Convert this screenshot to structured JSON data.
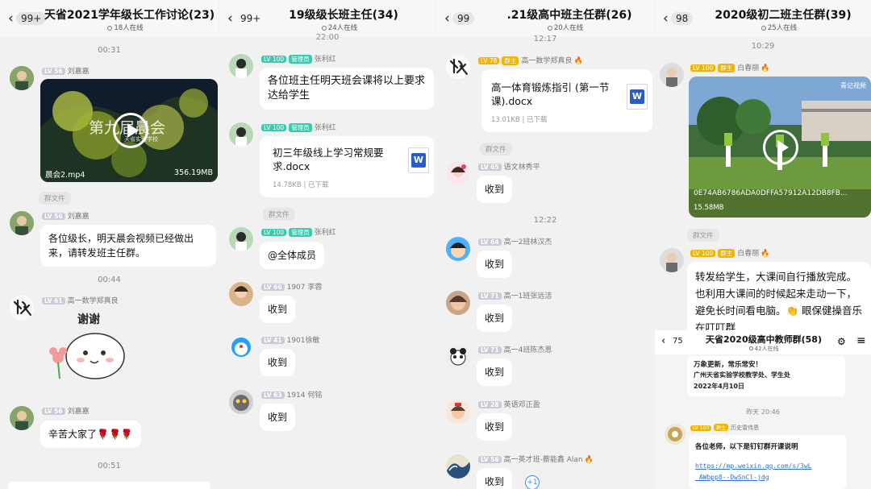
{
  "panel1": {
    "unread": "99+",
    "title": "天省2021学年级长工作讨论(23)",
    "online": "18人在线",
    "time1": "00:31",
    "msg1": {
      "lv": "LV 56",
      "name": "刘嘉嘉",
      "video_file": "晨会2.mp4",
      "video_size": "356.19MB",
      "video_text": "第九届晨会",
      "video_sub": "天省实验学校"
    },
    "badge": "群文件",
    "msg2": {
      "lv": "LV 56",
      "name": "刘嘉嘉",
      "text": "各位级长，明天晨会视频已经做出来，请转发班主任群。"
    },
    "time2": "00:44",
    "msg3": {
      "lv": "LV 61",
      "name": "高一数学郑真良",
      "sticker_text": "谢谢"
    },
    "msg4": {
      "lv": "LV 56",
      "name": "刘嘉嘉",
      "text": "辛苦大家了🌹🌹🌹"
    },
    "time3": "00:51"
  },
  "panel2": {
    "unread": "99+",
    "title": "19级级长班主任(34)",
    "online": "24人在线",
    "time1": "22:00",
    "msg1": {
      "lv": "LV 100",
      "role": "管理员",
      "name": "张利红",
      "text": "各位班主任明天班会课将以上要求达给学生"
    },
    "msg2": {
      "lv": "LV 100",
      "role": "管理员",
      "name": "张利红",
      "file": "初三年级线上学习常规要求.docx",
      "size": "14.78KB | 已下载"
    },
    "badge": "群文件",
    "msg3": {
      "lv": "LV 100",
      "role": "管理员",
      "name": "张利红",
      "text": "@全体成员"
    },
    "msg4": {
      "lv": "LV 66",
      "name": "1907 李蓉",
      "text": "收到"
    },
    "msg5": {
      "lv": "LV 41",
      "name": "1901徐敏",
      "text": "收到"
    },
    "msg6": {
      "lv": "LV 63",
      "name": "1914 何铭",
      "text": "收到"
    }
  },
  "panel3": {
    "unread": "99",
    "title": ".21级高中班主任群(26)",
    "online": "20人在线",
    "time1": "12:17",
    "msg1": {
      "lv": "LV 78",
      "role": "群主",
      "name": "高一数学郑真良",
      "file": "高一体育锻炼指引 (第一节课).docx",
      "size": "13.01KB | 已下载"
    },
    "badge": "群文件",
    "msg2": {
      "lv": "LV 65",
      "name": "语文林秀平",
      "text": "收到"
    },
    "time2": "12:22",
    "msg3": {
      "lv": "LV 64",
      "name": "高一2班林汉杰",
      "text": "收到"
    },
    "msg4": {
      "lv": "LV 71",
      "name": "高一1班张远洁",
      "text": "收到"
    },
    "msg5": {
      "lv": "LV 71",
      "name": "高一4班陈杰恩",
      "text": "收到"
    },
    "msg6": {
      "lv": "LV 28",
      "name": "英语邓正盈",
      "text": "收到"
    },
    "msg7": {
      "lv": "LV 56",
      "name": "高一英才班-蔡能鑫 Alan",
      "text": "收到"
    },
    "plus": "+1"
  },
  "panel4": {
    "unread": "98",
    "title": "2020级初二班主任群(39)",
    "online": "25人在线",
    "time1": "10:29",
    "msg1": {
      "lv": "LV 100",
      "role": "群主",
      "name": "白春丽",
      "video_file": "0E74AB6786ADA0DFFA57912A12DB8FB...",
      "video_size": "15.58MB",
      "watermark": "青记视频"
    },
    "badge": "群文件",
    "msg2": {
      "lv": "LV 100",
      "role": "群主",
      "name": "白春丽",
      "text": "转发给学生，大课间自行播放完成。也利用大课间的时候起来走动一下，避免长时间看电脑。👏 眼保健操音乐在叮叮群"
    },
    "inset": {
      "unread": "75",
      "title": "天省2020级高中教师群(58)",
      "online": "42人在线",
      "notice_line1": "万象更新，常乐常安！",
      "notice_line2": "广州天省实验学校教学处、学生处",
      "notice_line3": "2022年4月10日",
      "time": "昨天 20:46",
      "lv": "LV 100",
      "role": "群主",
      "name": "历史雷伟恩",
      "text": "各位老师，以下是钉钉群开课说明",
      "link1": "https://mp.weixin.qq.com/s/3wL",
      "link2": "_AWbpp8--DwSnCl-jdg"
    }
  }
}
